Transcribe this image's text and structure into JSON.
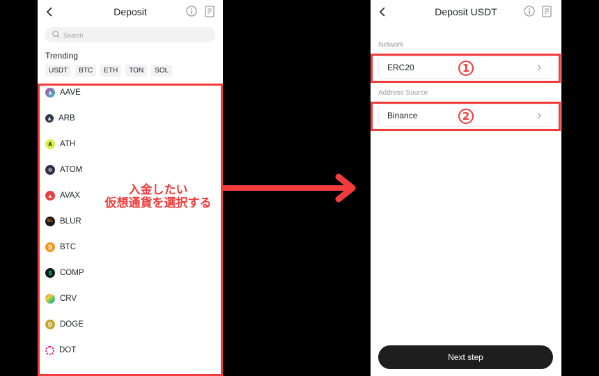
{
  "left_screen": {
    "header": {
      "title": "Deposit",
      "back_icon": "chevron-left-icon",
      "info_icon": "info-icon",
      "history_icon": "document-icon"
    },
    "search": {
      "placeholder": "Search"
    },
    "trending": {
      "label": "Trending",
      "chips": [
        "USDT",
        "BTC",
        "ETH",
        "TON",
        "SOL"
      ]
    },
    "coins": [
      {
        "symbol": "AAVE",
        "color": "#9b6fc4"
      },
      {
        "symbol": "ARB",
        "color": "#2d374b"
      },
      {
        "symbol": "ATH",
        "color": "#d4f14a"
      },
      {
        "symbol": "ATOM",
        "color": "#2e3148"
      },
      {
        "symbol": "AVAX",
        "color": "#e84142"
      },
      {
        "symbol": "BLUR",
        "color": "#1a1a1a"
      },
      {
        "symbol": "BTC",
        "color": "#f7931a"
      },
      {
        "symbol": "COMP",
        "color": "#0a1e17"
      },
      {
        "symbol": "CRV",
        "color": "#e84e4e"
      },
      {
        "symbol": "DOGE",
        "color": "#c2a633"
      },
      {
        "symbol": "DOT",
        "color": "#e6007a"
      }
    ]
  },
  "annotation": {
    "line1": "入金したい",
    "line2": "仮想通貨を選択する",
    "color": "#f23b3b"
  },
  "right_screen": {
    "header": {
      "title": "Deposit USDT",
      "back_icon": "chevron-left-icon",
      "info_icon": "info-icon",
      "history_icon": "document-icon"
    },
    "network": {
      "label": "Network",
      "value": "ERC20",
      "step": "1"
    },
    "address_source": {
      "label": "Address Source",
      "value": "Binance",
      "step": "2"
    },
    "next_button": "Next step"
  }
}
